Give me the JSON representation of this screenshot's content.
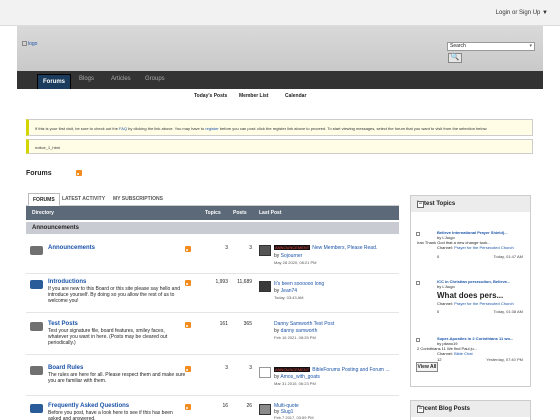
{
  "topbar": {
    "login": "Login or Sign Up ▼"
  },
  "header": {
    "logo_alt": "logo",
    "search_placeholder": "Search",
    "search_dropdown": "▾",
    "search_button": "🔍"
  },
  "nav": {
    "tabs": [
      "Forums",
      "Blogs",
      "Articles",
      "Groups"
    ]
  },
  "subnav": [
    "Today's Posts",
    "Member List",
    "Calendar"
  ],
  "notice": {
    "text_pre": "If this is your first visit, be sure to check out the ",
    "faq": "FAQ",
    "text_mid": " by clicking the link above. You may have to ",
    "register": "register",
    "text_post": " before you can post: click the register link above to proceed. To start viewing messages, select the forum that you want to visit from the selection below."
  },
  "notice2": {
    "text": "notice_1_html"
  },
  "forums_title": "Forums",
  "tabs": [
    "FORUMS",
    "LATEST ACTIVITY",
    "MY SUBSCRIPTIONS"
  ],
  "table_headers": {
    "directory": "Directory",
    "topics": "Topics",
    "posts": "Posts",
    "last_post": "Last Post"
  },
  "category": "Announcements",
  "forums": [
    {
      "name": "Announcements",
      "desc": "",
      "topics": "3",
      "posts": "3",
      "icon_color": "gray",
      "last_post_tag": "ANNOUNCEMENT",
      "last_post_title": "New Members, Please Read.",
      "last_post_by": "Sojourner",
      "last_post_date": "May 28 2020, 08:21 PM"
    },
    {
      "name": "Introductions",
      "desc": "If you are new to this Board or this site please say hello and introduce yourself. By doing so you allow the rest of us to welcome you!",
      "topics": "1,993",
      "posts": "11,689",
      "icon_color": "blue",
      "last_post_tag": "",
      "last_post_title": "It's been soooooo long",
      "last_post_by": "Jean74",
      "last_post_date": "Today, 03:43 AM"
    },
    {
      "name": "Test Posts",
      "desc": "Test your signature file, board features, smiley faces, whatever you want in here. (Posts may be cleared out periodically.)",
      "topics": "161",
      "posts": "365",
      "icon_color": "gray",
      "last_post_tag": "",
      "last_post_title": "Danny Samworth Test Post",
      "last_post_by": "danny samworth",
      "last_post_date": "Feb 16 2021, 08:25 PM"
    },
    {
      "name": "Board Rules",
      "desc": "The rules are here for all. Please respect them and make sure you are familiar with them.",
      "topics": "3",
      "posts": "3",
      "icon_color": "gray",
      "last_post_tag": "ANNOUNCEMENT",
      "last_post_title": "BibleForums Posting and Forum ...",
      "last_post_by": "Amos_with_goats",
      "last_post_date": "Mar 31 2015, 06:23 PM"
    },
    {
      "name": "Frequently Asked Questions",
      "desc": "Before you post, have a look here to see if this has been asked and answered.",
      "topics": "16",
      "posts": "26",
      "icon_color": "blue",
      "last_post_tag": "",
      "last_post_title": "Multi-quote",
      "last_post_by": "Slug1",
      "last_post_date": "Feb 7 2017, 03:59 PM"
    }
  ],
  "latest_topics": {
    "title": "Latest Topics",
    "items": [
      {
        "title": "Believe International Prayer Shield(...",
        "by": "L'Augo",
        "line": "Iran Thank God that a new change took...",
        "channel": "Prayer for the Persecuted Church",
        "replies": "0",
        "date": "Today, 01:47 AM"
      },
      {
        "title": "ICC in Christian persecution, Believe...",
        "by": "L'Augo",
        "line": "What does pers...",
        "channel": "Prayer for the Persecuted Church",
        "replies": "0",
        "date": "Today, 01:38 AM"
      },
      {
        "title": "Super-Apostles in 2 Corinthians 11 wo...",
        "by": "pilano19",
        "line": "2 Corinthians 11 We find Paul ju...",
        "channel": "Bible Chat",
        "replies": "12",
        "date": "Yesterday, 07:40 PM"
      }
    ],
    "view_all": "View All"
  },
  "recent_blog": {
    "title": "Recent Blog Posts"
  }
}
